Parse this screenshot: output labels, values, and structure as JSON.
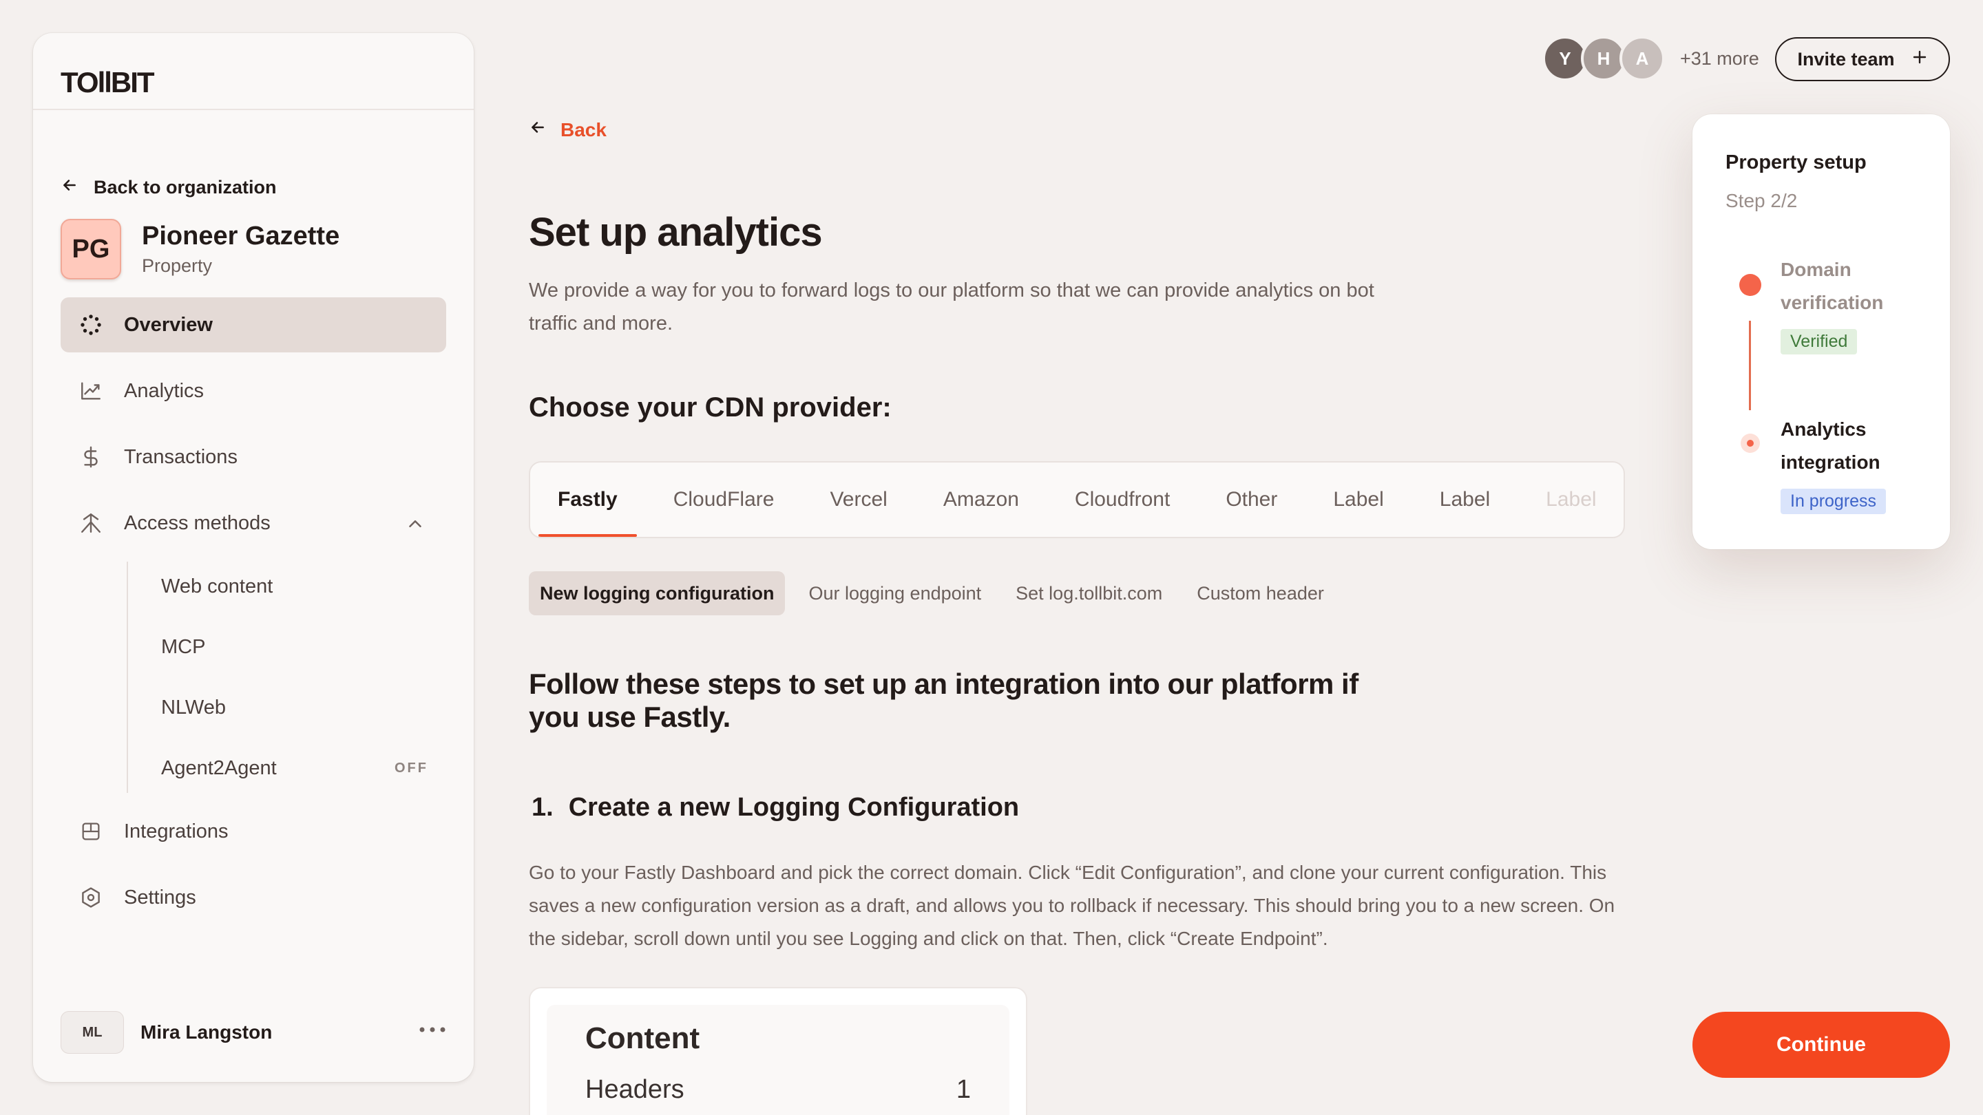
{
  "brand": {
    "logo_text": "TOllBIT"
  },
  "sidebar": {
    "back_label": "Back to organization",
    "property": {
      "initials": "PG",
      "name": "Pioneer Gazette",
      "type": "Property"
    },
    "nav": [
      {
        "label": "Overview",
        "icon": "overview-icon",
        "active": true
      },
      {
        "label": "Analytics",
        "icon": "analytics-icon"
      },
      {
        "label": "Transactions",
        "icon": "dollar-icon"
      },
      {
        "label": "Access methods",
        "icon": "access-icon",
        "expanded": true
      },
      {
        "label": "Integrations",
        "icon": "integrations-icon"
      },
      {
        "label": "Settings",
        "icon": "settings-icon"
      }
    ],
    "access_sub": [
      {
        "label": "Web content"
      },
      {
        "label": "MCP"
      },
      {
        "label": "NLWeb"
      },
      {
        "label": "Agent2Agent",
        "badge": "OFF"
      }
    ],
    "user": {
      "initials": "ML",
      "name": "Mira Langston"
    }
  },
  "topbar": {
    "avatars": [
      {
        "initial": "Y",
        "color": "#6f625e"
      },
      {
        "initial": "H",
        "color": "#a89d99"
      },
      {
        "initial": "A",
        "color": "#c8bfbc"
      }
    ],
    "more_label": "+31 more",
    "invite_label": "Invite team"
  },
  "main": {
    "back_label": "Back",
    "title": "Set up analytics",
    "description": "We provide a way for you to forward logs to our platform so that we can provide analytics on bot traffic and more.",
    "cdn_heading": "Choose your CDN provider:",
    "cdn_tabs": [
      "Fastly",
      "CloudFlare",
      "Vercel",
      "Amazon",
      "Cloudfront",
      "Other",
      "Label",
      "Label",
      "Label"
    ],
    "cdn_active": "Fastly",
    "sub_tabs": [
      "New logging configuration",
      "Our logging endpoint",
      "Set log.tollbit.com",
      "Custom header"
    ],
    "follow_heading": "Follow these steps to set up an integration into our platform if you use Fastly.",
    "step_number": "1.",
    "step_title": "Create a new Logging Configuration",
    "step_body": "Go to your Fastly Dashboard and pick the correct domain. Click “Edit Configuration”, and clone your current configuration. This saves a new configuration version as a draft, and allows you to rollback if necessary. This should bring you to a new screen. On the sidebar, scroll down until you see Logging and click on that. Then, click “Create Endpoint”.",
    "content_card": {
      "title": "Content",
      "row_label": "Headers",
      "row_value": "1"
    }
  },
  "setup": {
    "title": "Property setup",
    "step": "Step 2/2",
    "steps": [
      {
        "label": "Domain verification",
        "status": "Verified"
      },
      {
        "label": "Analytics integration",
        "status": "In progress"
      }
    ]
  },
  "continue_label": "Continue",
  "colors": {
    "accent": "#f4471f",
    "background": "#f4f0ee",
    "active_nav": "#e4dad6"
  }
}
